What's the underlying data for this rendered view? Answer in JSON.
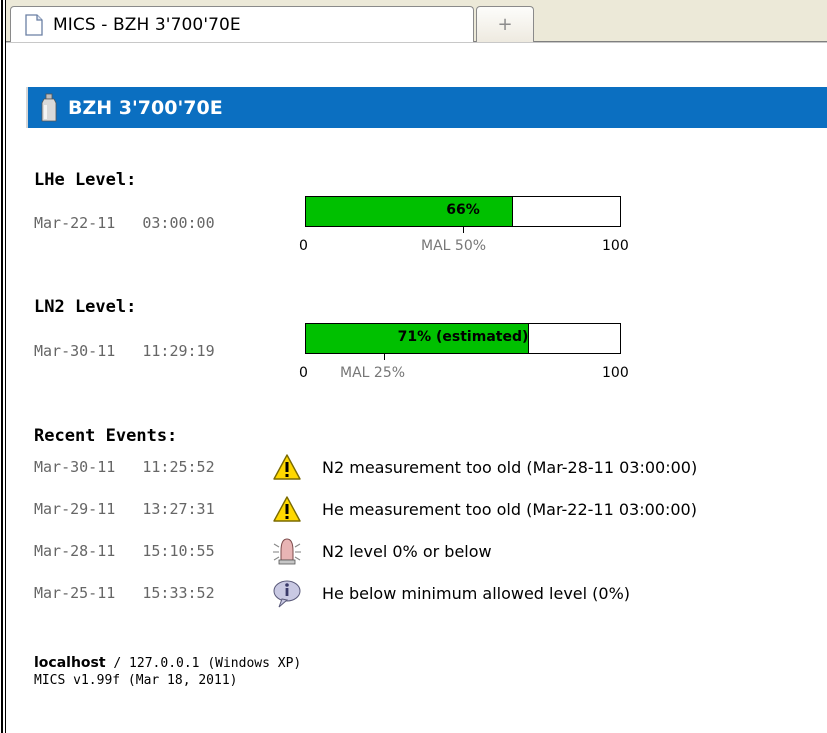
{
  "tab": {
    "title": "MICS - BZH 3'700'70E",
    "new_tab_symbol": "+"
  },
  "header": {
    "title": "BZH 3'700'70E"
  },
  "lhe": {
    "title": "LHe Level:",
    "timestamp": "Mar-22-11   03:00:00",
    "level_percent": 66,
    "bar_label": "66%",
    "scale_min": "0",
    "scale_max": "100",
    "mal_label": "MAL 50%",
    "mal_percent": 50,
    "fill_color": "#00c000"
  },
  "ln2": {
    "title": "LN2 Level:",
    "timestamp": "Mar-30-11   11:29:19",
    "level_percent": 71,
    "bar_label": "71% (estimated)",
    "scale_min": "0",
    "scale_max": "100",
    "mal_label": "MAL 25%",
    "mal_percent": 25,
    "fill_color": "#00c000"
  },
  "events": {
    "title": "Recent Events:",
    "items": [
      {
        "time": "Mar-30-11   11:25:52",
        "icon": "warning-icon",
        "text": "N2 measurement too old (Mar-28-11 03:00:00)"
      },
      {
        "time": "Mar-29-11   13:27:31",
        "icon": "warning-icon",
        "text": "He measurement too old (Mar-22-11 03:00:00)"
      },
      {
        "time": "Mar-28-11   15:10:55",
        "icon": "alarm-bell-icon",
        "text": "N2 level 0% or below"
      },
      {
        "time": "Mar-25-11   15:33:52",
        "icon": "info-bubble-icon",
        "text": "He below minimum allowed level (0%)"
      }
    ]
  },
  "footer": {
    "host": "localhost",
    "host_rest": " / 127.0.0.1 (Windows XP)",
    "version": "MICS v1.99f (Mar 18, 2011)"
  }
}
